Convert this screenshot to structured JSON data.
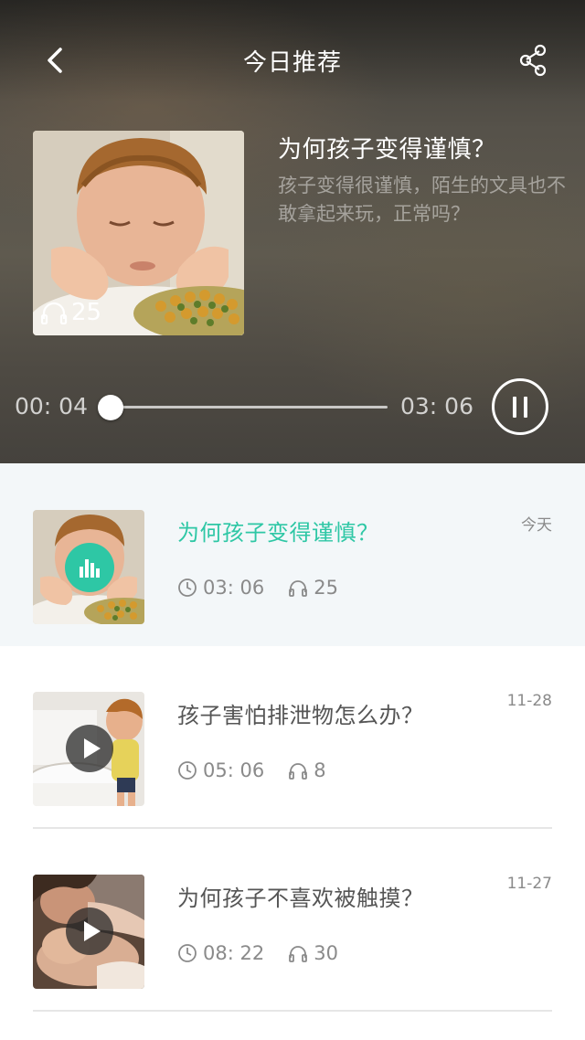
{
  "header": {
    "title": "今日推荐",
    "back_icon": "chevron-left-icon",
    "share_icon": "share-icon"
  },
  "player": {
    "title": "为何孩子变得谨慎？",
    "description": "孩子变得很谨慎，陌生的文具也不敢拿起来玩，正常吗？",
    "listen_count": "25",
    "current_time": "00: 04",
    "total_time": "03: 06",
    "progress_fraction": 0.022,
    "state": "playing",
    "accent_color": "#2ec7a5"
  },
  "list": [
    {
      "title": "为何孩子变得谨慎？",
      "date": "今天",
      "duration": "03: 06",
      "listens": "25",
      "status": "playing"
    },
    {
      "title": "孩子害怕排泄物怎么办？",
      "date": "11-28",
      "duration": "05: 06",
      "listens": "8",
      "status": "paused"
    },
    {
      "title": "为何孩子不喜欢被触摸？",
      "date": "11-27",
      "duration": "08: 22",
      "listens": "30",
      "status": "paused"
    }
  ]
}
